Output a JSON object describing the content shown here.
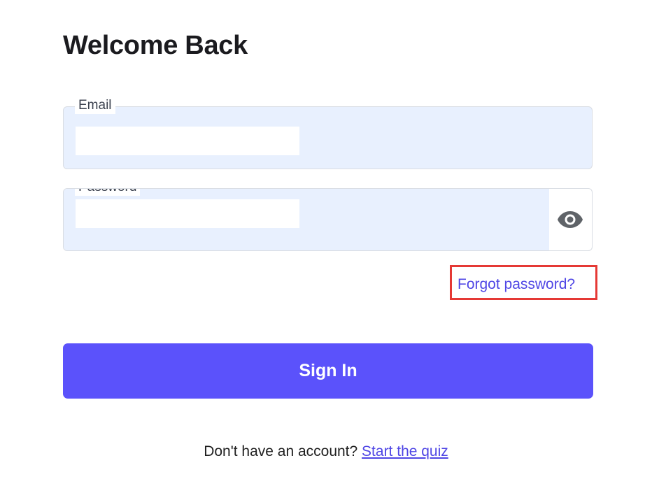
{
  "header": {
    "title": "Welcome Back"
  },
  "form": {
    "email": {
      "label": "Email",
      "value": ""
    },
    "password": {
      "label": "Password",
      "value": "",
      "toggle_icon": "eye-icon"
    },
    "forgot_password_label": "Forgot password?",
    "submit_label": "Sign In"
  },
  "footer": {
    "prompt": "Don't have an account?",
    "link_label": "Start the quiz"
  },
  "colors": {
    "accent": "#5b52fb",
    "link": "#4f46e5",
    "autofill_background": "#e8f0fe",
    "highlight_box": "#e53935"
  }
}
